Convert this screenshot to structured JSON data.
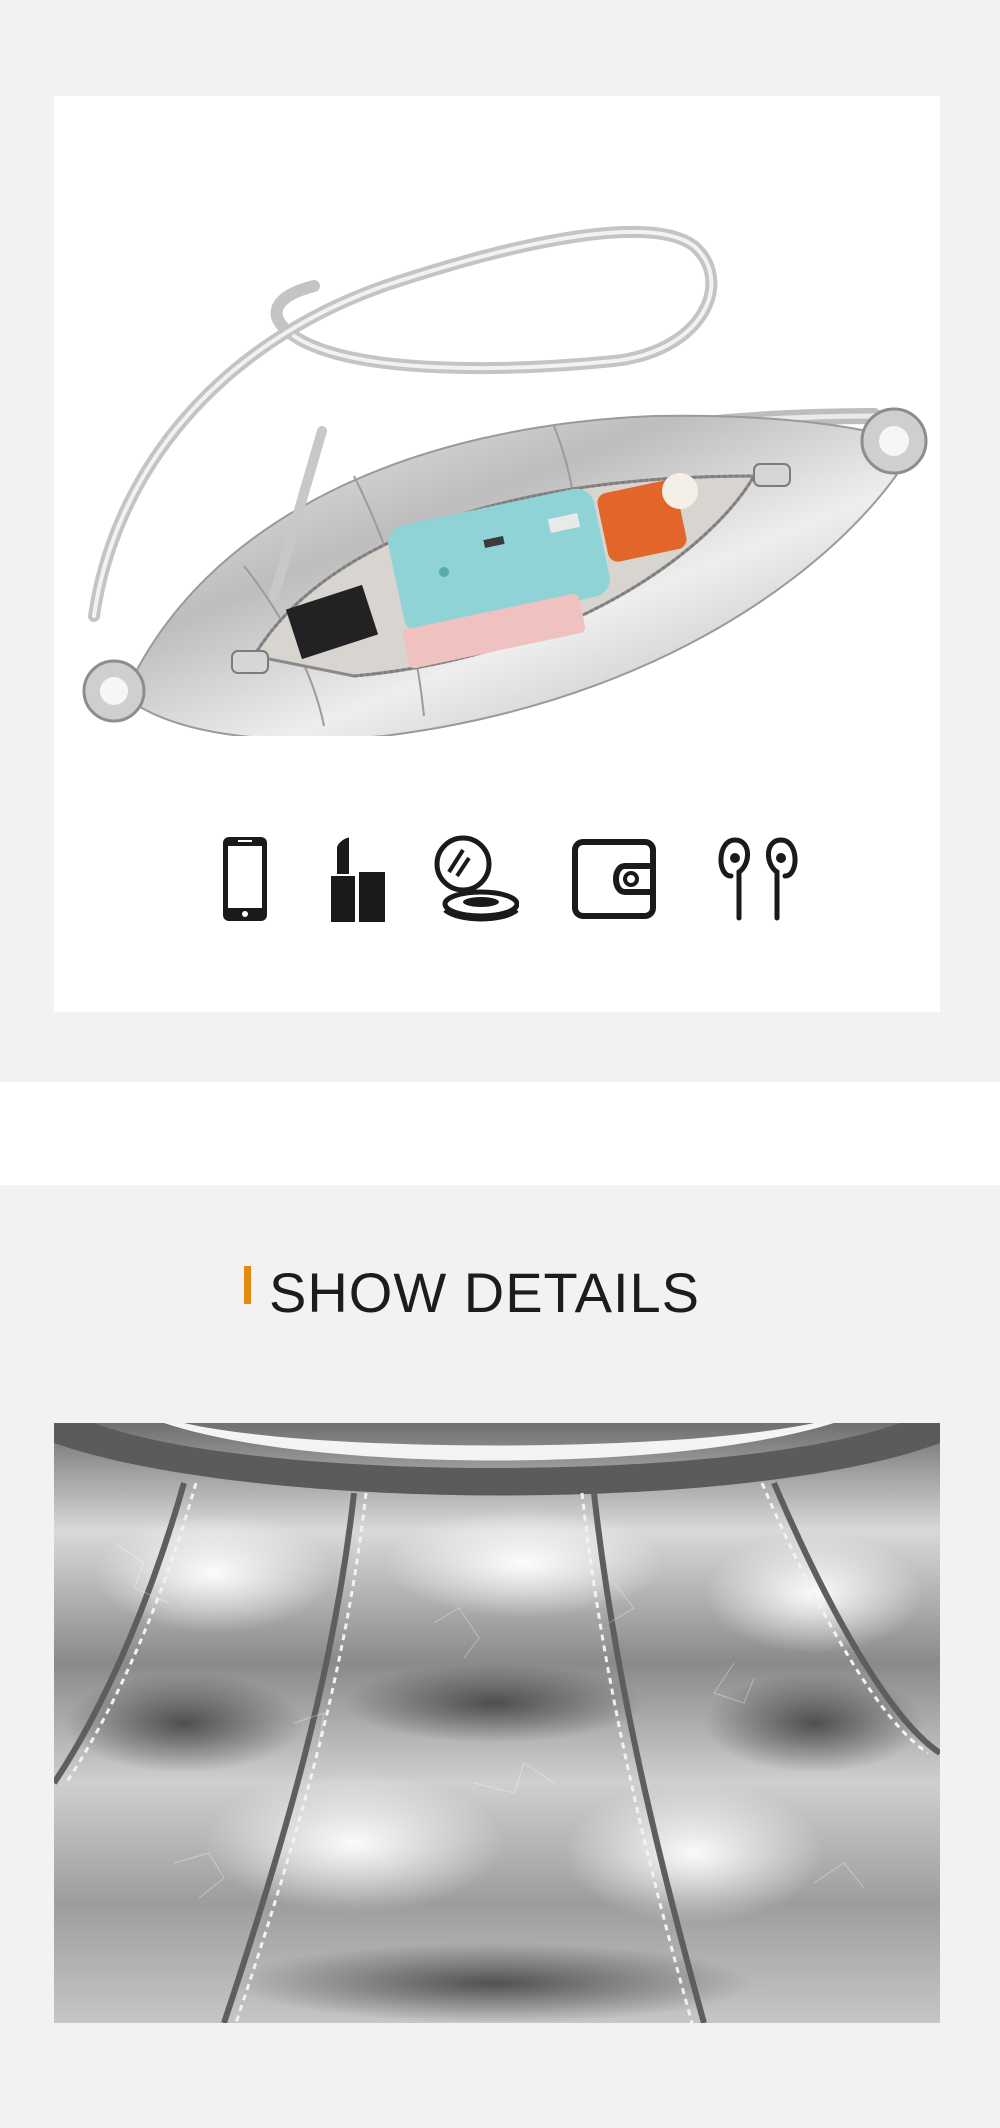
{
  "top_section": {
    "photo": {
      "subject": "silver-bag-open-interior"
    },
    "icons": [
      {
        "name": "phone-icon"
      },
      {
        "name": "lipstick-icon"
      },
      {
        "name": "compact-mirror-icon"
      },
      {
        "name": "wallet-icon"
      },
      {
        "name": "earphones-icon"
      }
    ]
  },
  "details_section": {
    "heading": "SHOW DETAILS",
    "accent_color": "#e58a10",
    "photo": {
      "subject": "silver-leather-pleat-closeup"
    }
  },
  "colors": {
    "background": "#f3f1f2",
    "card": "#ffffff",
    "icon": "#1a1a1a"
  }
}
